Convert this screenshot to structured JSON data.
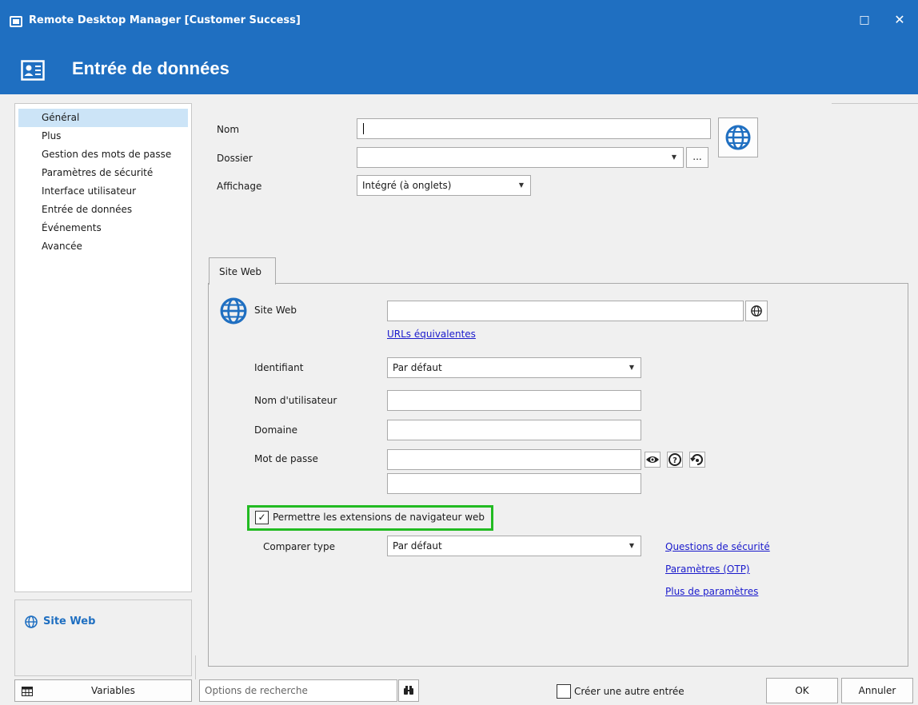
{
  "window": {
    "title": "Remote Desktop Manager [Customer Success]",
    "maximize_glyph": "□",
    "close_glyph": "✕"
  },
  "header": {
    "title": "Entrée de données",
    "icon": "contact-card-icon"
  },
  "sidebar": {
    "items": [
      {
        "label": "Général",
        "selected": true
      },
      {
        "label": "Plus"
      },
      {
        "label": "Gestion des mots de passe"
      },
      {
        "label": "Paramètres de sécurité"
      },
      {
        "label": "Interface utilisateur"
      },
      {
        "label": "Entrée de données"
      },
      {
        "label": "Événements"
      },
      {
        "label": "Avancée"
      }
    ],
    "pane_label": "Site Web"
  },
  "form": {
    "nom_label": "Nom",
    "nom_value": "",
    "dossier_label": "Dossier",
    "dossier_value": "",
    "dossier_more": "...",
    "affichage_label": "Affichage",
    "affichage_value": "Intégré (à onglets)"
  },
  "tabs": [
    {
      "label": "Site Web",
      "active": true
    }
  ],
  "website": {
    "site_label": "Site Web",
    "site_value": "",
    "equiv_link": "URLs équivalentes",
    "identifiant_label": "Identifiant",
    "identifiant_value": "Par défaut",
    "username_label": "Nom d'utilisateur",
    "username_value": "",
    "domaine_label": "Domaine",
    "domaine_value": "",
    "password_label": "Mot de passe",
    "password_value": "",
    "extensions_label": "Permettre les extensions de navigateur web",
    "extensions_checked": true,
    "check_glyph": "✓",
    "comparer_label": "Comparer type",
    "comparer_value": "Par défaut",
    "links": [
      "Questions de sécurité",
      "Paramètres (OTP)",
      "Plus de paramètres"
    ]
  },
  "footer": {
    "variables_label": "Variables",
    "search_placeholder": "Options de recherche",
    "create_another_label": "Créer une autre entrée",
    "ok_label": "OK",
    "cancel_label": "Annuler"
  },
  "colors": {
    "accent": "#1f6fc1",
    "selection": "#cce4f7",
    "highlight_frame": "#22bb22",
    "link": "#1a1acc"
  }
}
